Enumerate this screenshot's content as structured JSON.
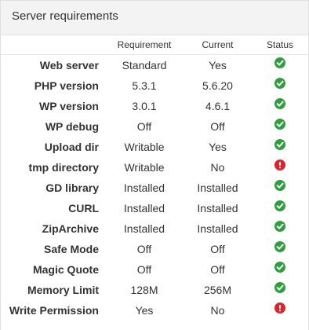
{
  "panel": {
    "title": "Server requirements"
  },
  "columns": {
    "requirement": "Requirement",
    "current": "Current",
    "status": "Status"
  },
  "rows": [
    {
      "label": "Web server",
      "requirement": "Standard",
      "current": "Yes",
      "status": "ok"
    },
    {
      "label": "PHP version",
      "requirement": "5.3.1",
      "current": "5.6.20",
      "status": "ok"
    },
    {
      "label": "WP version",
      "requirement": "3.0.1",
      "current": "4.6.1",
      "status": "ok"
    },
    {
      "label": "WP debug",
      "requirement": "Off",
      "current": "Off",
      "status": "ok"
    },
    {
      "label": "Upload dir",
      "requirement": "Writable",
      "current": "Yes",
      "status": "ok"
    },
    {
      "label": "tmp directory",
      "requirement": "Writable",
      "current": "No",
      "status": "error"
    },
    {
      "label": "GD library",
      "requirement": "Installed",
      "current": "Installed",
      "status": "ok"
    },
    {
      "label": "CURL",
      "requirement": "Installed",
      "current": "Installed",
      "status": "ok"
    },
    {
      "label": "ZipArchive",
      "requirement": "Installed",
      "current": "Installed",
      "status": "ok"
    },
    {
      "label": "Safe Mode",
      "requirement": "Off",
      "current": "Off",
      "status": "ok"
    },
    {
      "label": "Magic Quote",
      "requirement": "Off",
      "current": "Off",
      "status": "ok"
    },
    {
      "label": "Memory Limit",
      "requirement": "128M",
      "current": "256M",
      "status": "ok"
    },
    {
      "label": "Write Permission",
      "requirement": "Yes",
      "current": "No",
      "status": "error"
    }
  ],
  "colors": {
    "ok": "#2e9e3e",
    "error": "#d9232e"
  },
  "icons": {
    "ok": "check-circle-icon",
    "error": "exclamation-circle-icon"
  }
}
